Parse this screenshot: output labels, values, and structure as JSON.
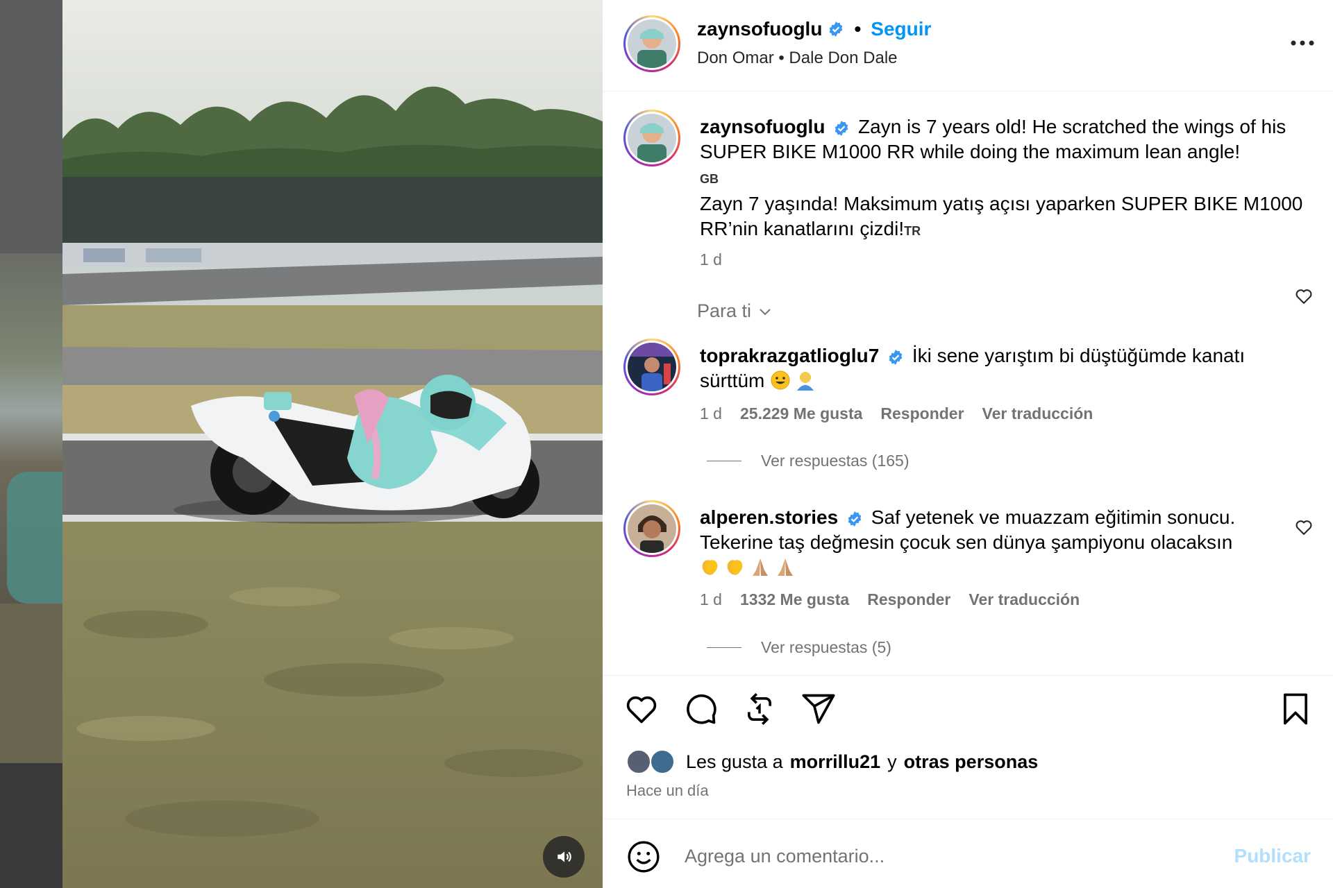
{
  "post": {
    "author": "zaynsofuoglu",
    "follow_label": "Seguir",
    "audio": "Don Omar • Dale Don Dale",
    "more_label": "..."
  },
  "caption": {
    "username": "zaynsofuoglu",
    "text_en": "Zayn is 7 years old! He scratched the wings of his SUPER BIKE M1000 RR while doing the maximum lean angle!",
    "flag_en": "GB",
    "text_tr": "Zayn 7 yaşında! Maksimum yatış açısı yaparken SUPER BIKE M1000 RR’nin kanatlarını çizdi!",
    "flag_tr": "TR",
    "time": "1 d"
  },
  "sort_label": "Para ti",
  "comments": [
    {
      "username": "toprakrazgatlioglu7",
      "text": "İki sene yarıştım bi düştüğümde kanatı sürttüm",
      "emojis": [
        "grinning-face-emoji",
        "bald-person-emoji"
      ],
      "time": "1 d",
      "likes": "25.229 Me gusta",
      "reply_label": "Responder",
      "translate_label": "Ver traducción",
      "view_replies": "Ver respuestas (165)"
    },
    {
      "username": "alperen.stories",
      "text": "Saf yetenek ve muazzam eğitimin sonucu. Tekerine taş değmesin çocuk sen dünya şampiyonu olacaksın",
      "emojis": [
        "clapping-hands-emoji",
        "clapping-hands-emoji",
        "folded-hands-emoji",
        "folded-hands-emoji"
      ],
      "time": "1 d",
      "likes": "1332 Me gusta",
      "reply_label": "Responder",
      "translate_label": "Ver traducción",
      "view_replies": "Ver respuestas (5)"
    }
  ],
  "likes_summary": {
    "prefix": "Les gusta a",
    "user": "morrillu21",
    "connector": "y",
    "others": "otras personas",
    "time": "Hace un día"
  },
  "comment_box": {
    "placeholder": "Agrega un comentario...",
    "post_label": "Publicar"
  },
  "colors": {
    "accent_blue": "#0095f6",
    "muted_text": "#737373",
    "post_disabled": "#b2dffc",
    "verified_blue": "#3897f0"
  },
  "icons": {
    "action_bar": [
      "heart-icon",
      "comment-icon",
      "repost-icon",
      "share-icon",
      "bookmark-icon"
    ],
    "media": [
      "speaker-icon"
    ]
  }
}
